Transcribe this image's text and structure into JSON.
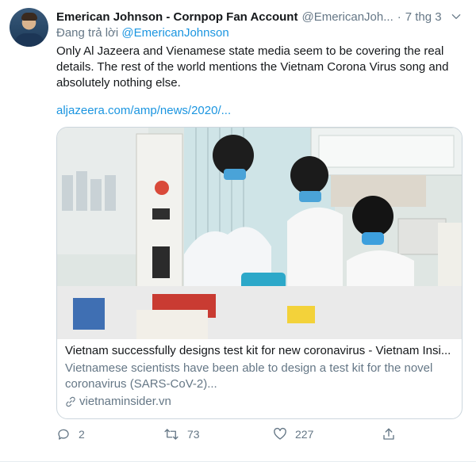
{
  "tweet": {
    "author_name": "Emerican Johnson - Cornpop Fan Account",
    "author_handle": "@EmericanJoh...",
    "separator": "·",
    "date": "7 thg 3",
    "replying_prefix": "Đang trả lời",
    "replying_to": "@EmericanJohnson",
    "text_line": "Only Al Jazeera and Vienamese state media seem to be covering the real details. The rest of the world mentions the Vietnam Corona Virus song and absolutely nothing else.",
    "link": "aljazeera.com/amp/news/2020/..."
  },
  "card": {
    "title": "Vietnam successfully designs test kit for new coronavirus - Vietnam Insi...",
    "description": "Vietnamese scientists have been able to design a test kit for the novel coronavirus (SARS-CoV-2)...",
    "domain": "vietnaminsider.vn",
    "image_alt": "Scientists wearing masks working in a lab"
  },
  "actions": {
    "replies": "2",
    "retweets": "73",
    "likes": "227"
  },
  "icons": {
    "caret": "chevron-down-icon",
    "reply": "reply-icon",
    "retweet": "retweet-icon",
    "like": "heart-icon",
    "share": "share-icon",
    "link": "link-icon"
  },
  "colors": {
    "link": "#1b95e0",
    "muted": "#657786",
    "text": "#14171a"
  }
}
